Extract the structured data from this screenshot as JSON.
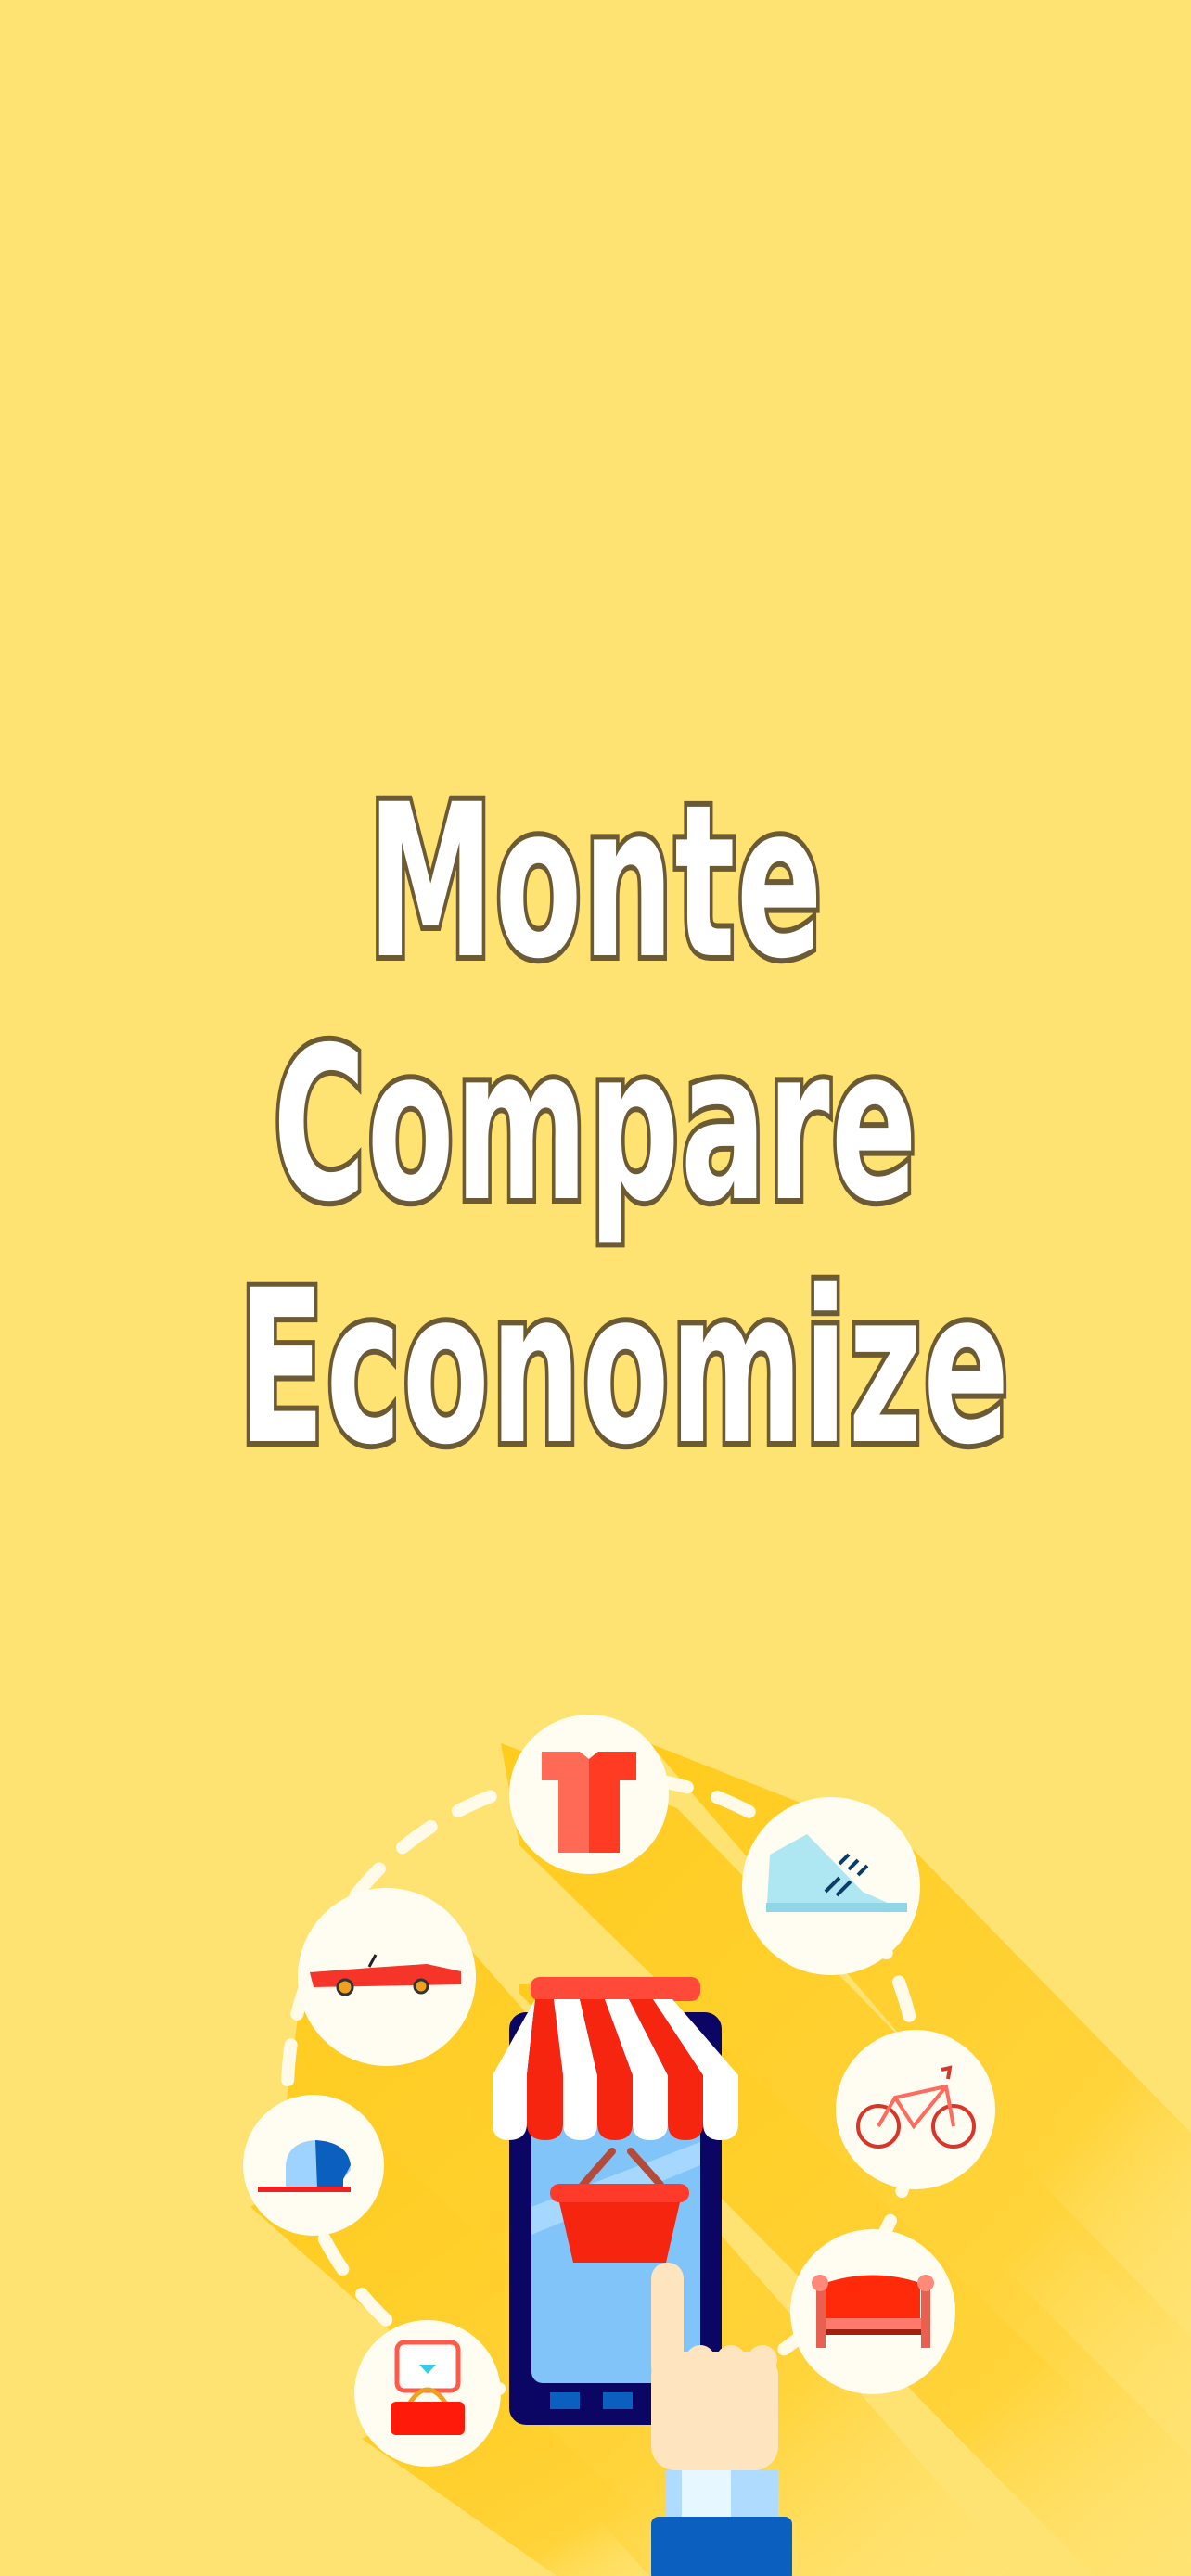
{
  "splash": {
    "title_lines": [
      "Monte",
      "Compare",
      "Economize"
    ]
  },
  "illustration": {
    "icons": [
      "tshirt-icon",
      "sneaker-icon",
      "bicycle-icon",
      "sofa-icon",
      "ring-box-icon",
      "cap-icon",
      "car-icon",
      "shop-phone-icon",
      "shopping-basket-icon",
      "pointing-hand-icon"
    ]
  },
  "colors": {
    "background": "#FFE372",
    "shadow": "#FFCC1E",
    "title_fill": "#FFFFFF",
    "title_stroke": "#6B5A34",
    "accent_red": "#F52A12",
    "phone_body": "#0B0563",
    "phone_screen": "#80C4FA",
    "sleeve": "#0A5FBF"
  }
}
